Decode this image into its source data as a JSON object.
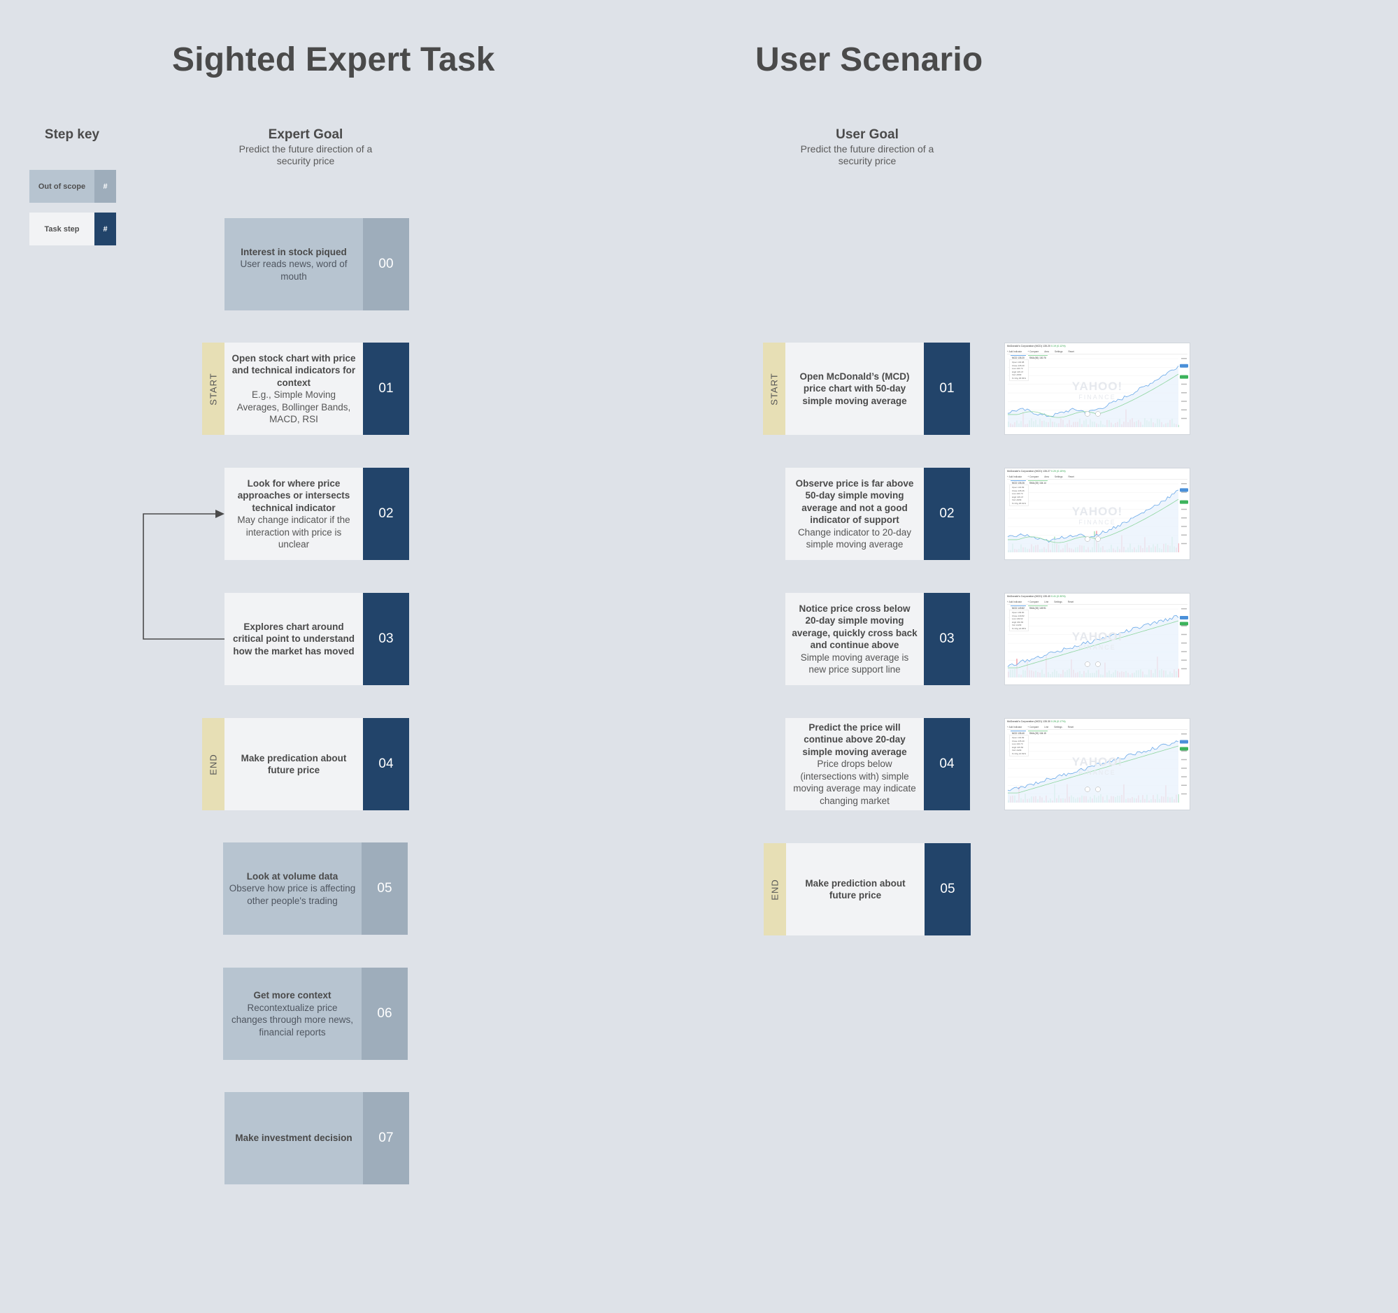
{
  "titles": {
    "left": "Sighted Expert Task",
    "right": "User Scenario"
  },
  "step_key": {
    "title": "Step key",
    "items": [
      {
        "label": "Out of scope",
        "symbol": "#",
        "kind": "out-of-scope"
      },
      {
        "label": "Task step",
        "symbol": "#",
        "kind": "task-step"
      }
    ]
  },
  "expert": {
    "goal_title": "Expert Goal",
    "goal_text": "Predict the future direction of a security price",
    "steps": [
      {
        "num": "00",
        "kind": "out-of-scope",
        "tag": "",
        "heading": "Interest in stock piqued",
        "detail": "User reads news, word of mouth"
      },
      {
        "num": "01",
        "kind": "task-step",
        "tag": "START",
        "heading": "Open stock chart with price and technical indicators for context",
        "detail": "E.g., Simple Moving Averages, Bollinger Bands, MACD, RSI"
      },
      {
        "num": "02",
        "kind": "task-step",
        "tag": "",
        "heading": "Look for where price approaches or intersects technical indicator",
        "detail": "May change indicator if the interaction with price is unclear"
      },
      {
        "num": "03",
        "kind": "task-step",
        "tag": "",
        "heading": "Explores chart around critical point to understand how the market has moved",
        "detail": ""
      },
      {
        "num": "04",
        "kind": "task-step",
        "tag": "END",
        "heading": "Make predication about future price",
        "detail": ""
      },
      {
        "num": "05",
        "kind": "out-of-scope",
        "tag": "",
        "heading": "Look at volume data",
        "detail": "Observe how price is affecting other people's trading"
      },
      {
        "num": "06",
        "kind": "out-of-scope",
        "tag": "",
        "heading": "Get more context",
        "detail": "Recontextualize price changes through more news, financial reports"
      },
      {
        "num": "07",
        "kind": "out-of-scope",
        "tag": "",
        "heading": "Make investment decision",
        "detail": ""
      }
    ],
    "loop_arrow": {
      "from_step": "03",
      "to_step": "02"
    }
  },
  "user": {
    "goal_title": "User Goal",
    "goal_text": "Predict the future direction of a security price",
    "steps": [
      {
        "num": "01",
        "kind": "task-step",
        "tag": "START",
        "heading": "Open McDonald’s (MCD) price chart with 50-day simple moving average",
        "detail": ""
      },
      {
        "num": "02",
        "kind": "task-step",
        "tag": "",
        "heading": "Observe price is far above 50-day simple moving average and not a good indicator of support",
        "detail": "Change indicator to 20-day simple moving average"
      },
      {
        "num": "03",
        "kind": "task-step",
        "tag": "",
        "heading": "Notice price cross below 20-day simple moving average, quickly cross back and continue above",
        "detail": "Simple moving average is new price support line"
      },
      {
        "num": "04",
        "kind": "task-step",
        "tag": "",
        "heading": "Predict the price will continue above 20-day simple moving average",
        "detail": "Price drops below (intersections with) simple moving average may indicate changing market"
      },
      {
        "num": "05",
        "kind": "task-step",
        "tag": "END",
        "heading": "Make prediction about future price",
        "detail": ""
      }
    ],
    "screenshots": [
      {
        "header": "McDonald's Corporation (MCD) 135.20",
        "change": "0.19 (0.12%)",
        "tools": [
          "+ Add Indicator",
          "+ Compare",
          "Area",
          "Settings",
          "Reset"
        ],
        "price_label": "MCD 135.20",
        "sma_label": "SMA (50) 130.76",
        "ohlc": [
          "Open 134.98",
          "Close 135.20",
          "Low 134.73",
          "High 135.47",
          "Vol 1.80M",
          "% Chg 35.56%"
        ],
        "watermark": "YAHOO!",
        "watermark_sub": "FINANCE"
      },
      {
        "header": "McDonald's Corporation (MCD) 135.27",
        "change": "0.20 (0.15%)",
        "tools": [
          "+ Add Indicator",
          "+ Compare",
          "Area",
          "Settings",
          "Reset"
        ],
        "price_label": "MCD 135.26",
        "sma_label": "SMA (20) 134.14",
        "ohlc": [
          "Open 134.99",
          "Close 135.26",
          "Low 134.73",
          "High 135.47",
          "Vol 1.82M",
          "% Chg 25.61%"
        ],
        "watermark": "YAHOO!",
        "watermark_sub": "FINANCE"
      },
      {
        "header": "McDonald's Corporation (MCD) 135.40",
        "change": "0.41 (0.30%)",
        "tools": [
          "+ Add Indicator",
          "+ Compare",
          "Line",
          "Settings",
          "Reset"
        ],
        "price_label": "MCD 149.82",
        "sma_label": "SMA (20) 149.91",
        "ohlc": [
          "Open 149.90",
          "Close 149.82",
          "Low 149.62",
          "High 150.65",
          "Vol 4.22M",
          "% Chg 24.95%"
        ],
        "watermark": "YAHOO!",
        "watermark_sub": "FINANCE"
      },
      {
        "header": "McDonald's Corporation (MCD) 135.30",
        "change": "0.26 (0.17%)",
        "tools": [
          "+ Add Indicator",
          "+ Compare",
          "Line",
          "Settings",
          "Reset"
        ],
        "price_label": "MCD 135.40",
        "sma_label": "SMA (20) 134.15",
        "ohlc": [
          "Open 134.99",
          "Close 135.40",
          "Low 134.73",
          "High 135.50",
          "Vol 1.92M",
          "% Chg 21.52%"
        ],
        "watermark": "YAHOO!",
        "watermark_sub": "FINANCE"
      }
    ]
  },
  "colors": {
    "background": "#dee2e8",
    "task_step_body": "#f2f3f5",
    "task_step_number": "#22446a",
    "out_of_scope_body": "#b7c4d0",
    "out_of_scope_number": "#9eadbb",
    "start_end_tab": "#e7dfb5",
    "arrow": "#4a4a4a"
  }
}
